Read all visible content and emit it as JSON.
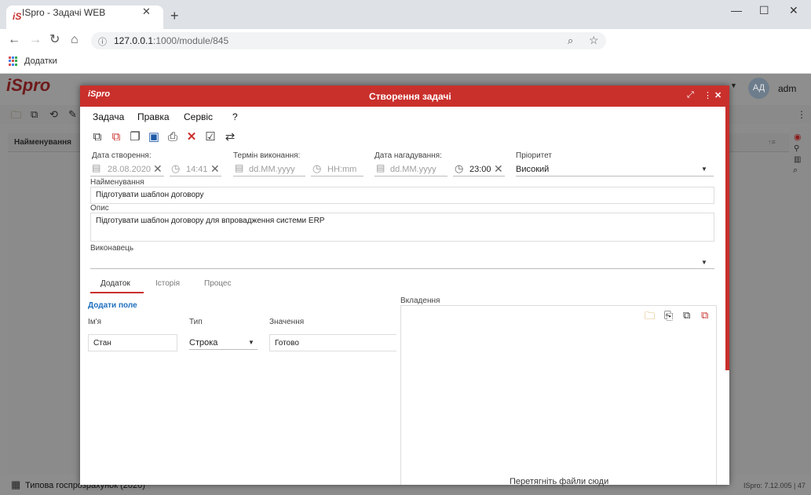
{
  "browser": {
    "tab_title": "ISpro - Задачі WEB",
    "new_tab_symbol": "+",
    "url_host": "127.0.0.1",
    "url_path": ":1000/module/845",
    "bookmark_label": "Додатки"
  },
  "app": {
    "logo": "iSpro",
    "avatar_initials": "АД",
    "user_name": "adm",
    "list_column": "Найменування",
    "status_left": "Типова госпрозрахунок (2020)",
    "status_right": "ISpro: 7.12.005 | 47"
  },
  "dialog": {
    "logo": "iSpro",
    "title": "Створення задачі",
    "menu": [
      "Задача",
      "Правка",
      "Сервіс",
      "?"
    ],
    "toolbar_icons": [
      "new-icon",
      "delete-doc-icon",
      "copy-icon",
      "save-icon",
      "print-icon",
      "close-red-icon",
      "checkbox-icon",
      "switch-icon"
    ],
    "created_label": "Дата створення:",
    "created_date": "28.08.2020",
    "created_time": "14:41",
    "deadline_label": "Термін виконання:",
    "deadline_date_placeholder": "dd.MM.yyyy",
    "deadline_time_placeholder": "HH:mm",
    "reminder_label": "Дата нагадування:",
    "reminder_date_placeholder": "dd.MM.yyyy",
    "reminder_time": "23:00",
    "priority_label": "Пріоритет",
    "priority_value": "Високий",
    "name_label": "Найменування",
    "name_value": "Підготувати шаблон договору",
    "description_label": "Опис",
    "description_value": "Підготувати шаблон договору для впровадження системи ERP",
    "assignee_label": "Виконавець",
    "assignee_value": "",
    "tabs": [
      "Додаток",
      "Історія",
      "Процес"
    ],
    "add_field_link": "Додати поле",
    "col_name": "Ім'я",
    "col_type": "Тип",
    "col_value": "Значення",
    "row_name": "Стан",
    "row_type": "Строка",
    "row_value": "Готово",
    "attachments_label": "Вкладення",
    "drop_hint": "Перетягніть файли сюди"
  },
  "colors": {
    "accent": "#c9302c",
    "link": "#1e6fbf",
    "overlay": "#8c8c8c"
  }
}
